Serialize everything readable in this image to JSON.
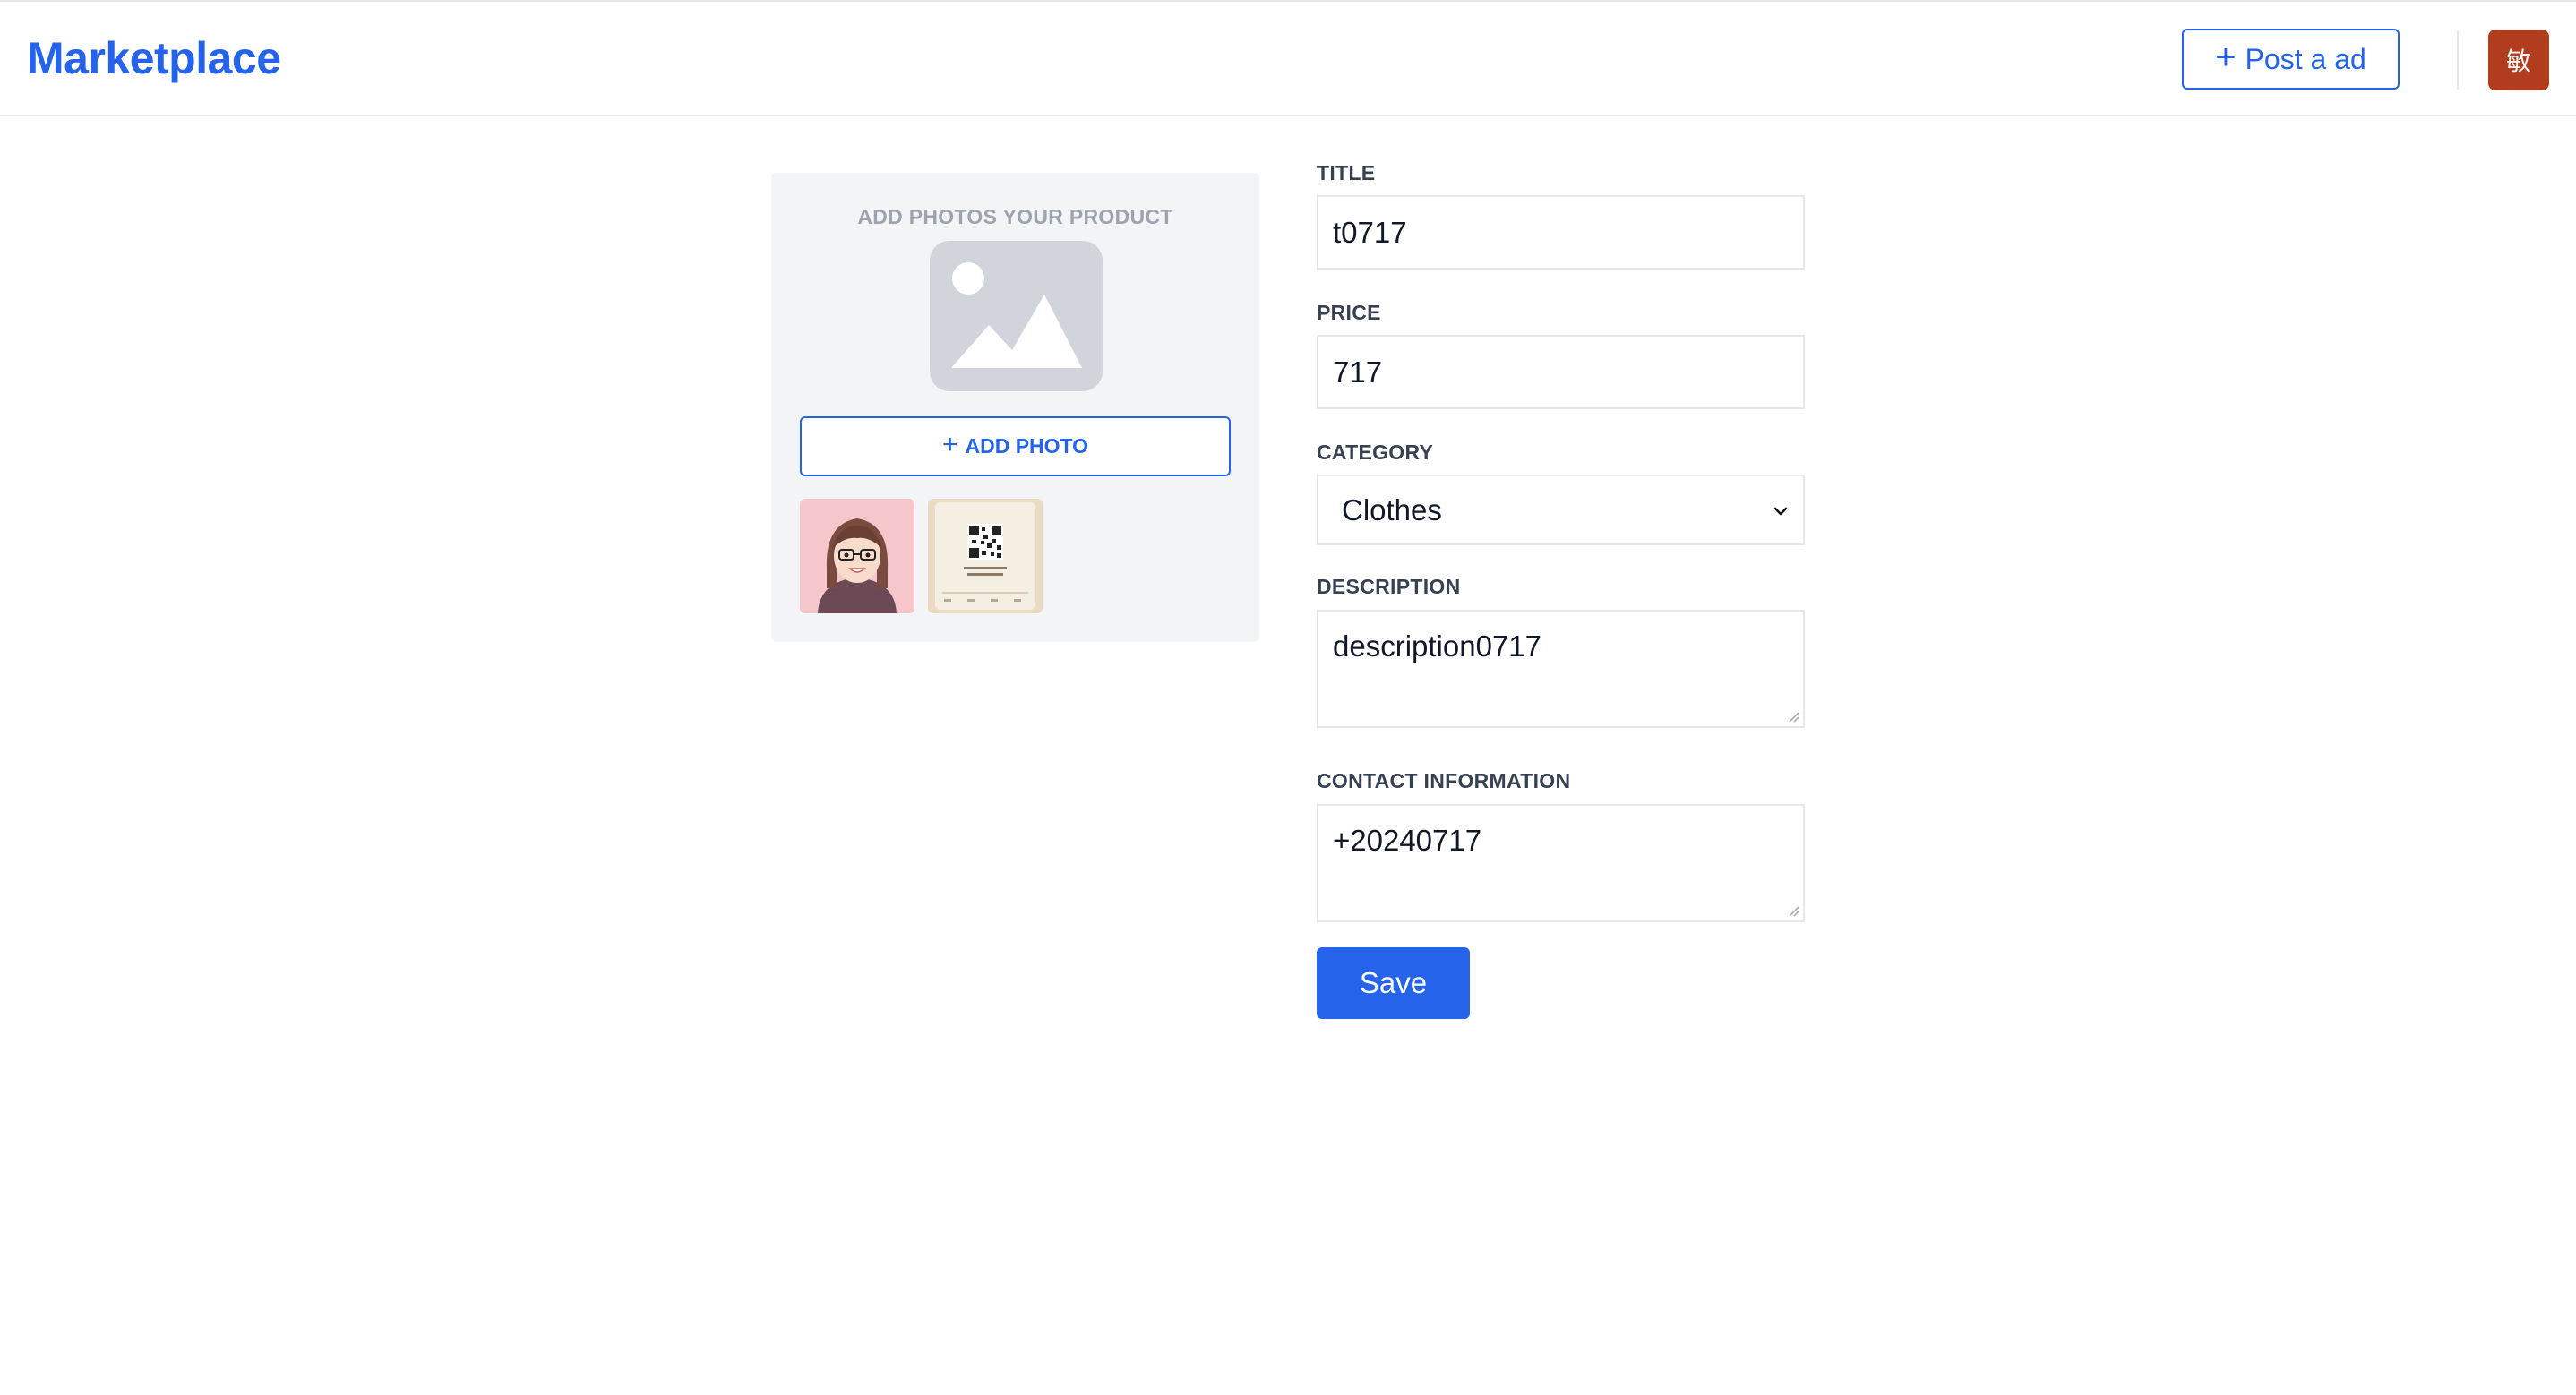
{
  "header": {
    "brand": "Marketplace",
    "post_button_label": "Post a ad",
    "avatar_initial": "敏",
    "avatar_color": "#b23c1e"
  },
  "photos": {
    "heading": "ADD PHOTOS YOUR PRODUCT",
    "add_button_label": "ADD PHOTO",
    "thumbnails": [
      "avatar-cartoon-thumbnail",
      "qr-code-card-thumbnail"
    ]
  },
  "form": {
    "title_label": "TITLE",
    "title_value": "t0717",
    "price_label": "PRICE",
    "price_value": "717",
    "category_label": "CATEGORY",
    "category_value": "Clothes",
    "description_label": "DESCRIPTION",
    "description_value": "description0717",
    "contact_label": "CONTACT INFORMATION",
    "contact_value": "+20240717",
    "save_label": "Save"
  },
  "colors": {
    "accent": "#2563eb",
    "panel": "#f3f4f6",
    "border": "#e5e7eb"
  }
}
